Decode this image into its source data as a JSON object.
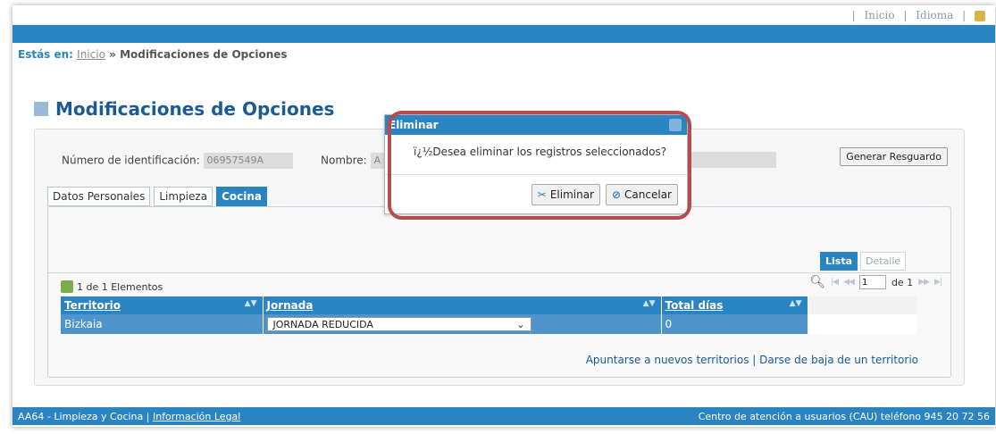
{
  "top_links": {
    "inicio": "Inicio",
    "idioma": "Idioma",
    "separator": "|"
  },
  "breadcrumb": {
    "label": "Estás en:",
    "home": "Inicio",
    "sep": "»",
    "current": "Modificaciones de Opciones"
  },
  "page_title": "Modificaciones de Opciones",
  "form": {
    "id_label": "Número de identificación:",
    "id_value": "06957549A",
    "name_label": "Nombre:",
    "name_value": "A",
    "resguardo_button": "Generar Resguardo"
  },
  "tabs": [
    {
      "label": "Datos Personales",
      "active": false
    },
    {
      "label": "Limpieza",
      "active": false
    },
    {
      "label": "Cocina",
      "active": true
    }
  ],
  "view_tabs": {
    "list": "Lista",
    "detail": "Detalle"
  },
  "grid": {
    "count_text": "1 de 1 Elementos",
    "pager": {
      "page_input": "1",
      "of_text": "de 1"
    },
    "columns": [
      "Territorio",
      "Jornada",
      "Total días"
    ],
    "rows": [
      {
        "territorio": "Bizkaia",
        "jornada": "JORNADA REDUCIDA",
        "total": "0"
      }
    ],
    "links": {
      "join": "Apuntarse a nuevos territorios",
      "sep": "|",
      "leave": "Darse de baja de un territorio"
    }
  },
  "footer": {
    "left_prefix": "AA64 - Limpieza y Cocina |",
    "left_link": "Información Legal",
    "right": "Centro de atención a usuarios (CAU) teléfono 945 20 72 56"
  },
  "dialog": {
    "title": "Eliminar",
    "message": "ï¿½Desea eliminar los registros seleccionados?",
    "confirm": "Eliminar",
    "cancel": "Cancelar"
  },
  "colors": {
    "brand_blue": "#2b84c2",
    "highlight_red": "#b84b4b"
  }
}
